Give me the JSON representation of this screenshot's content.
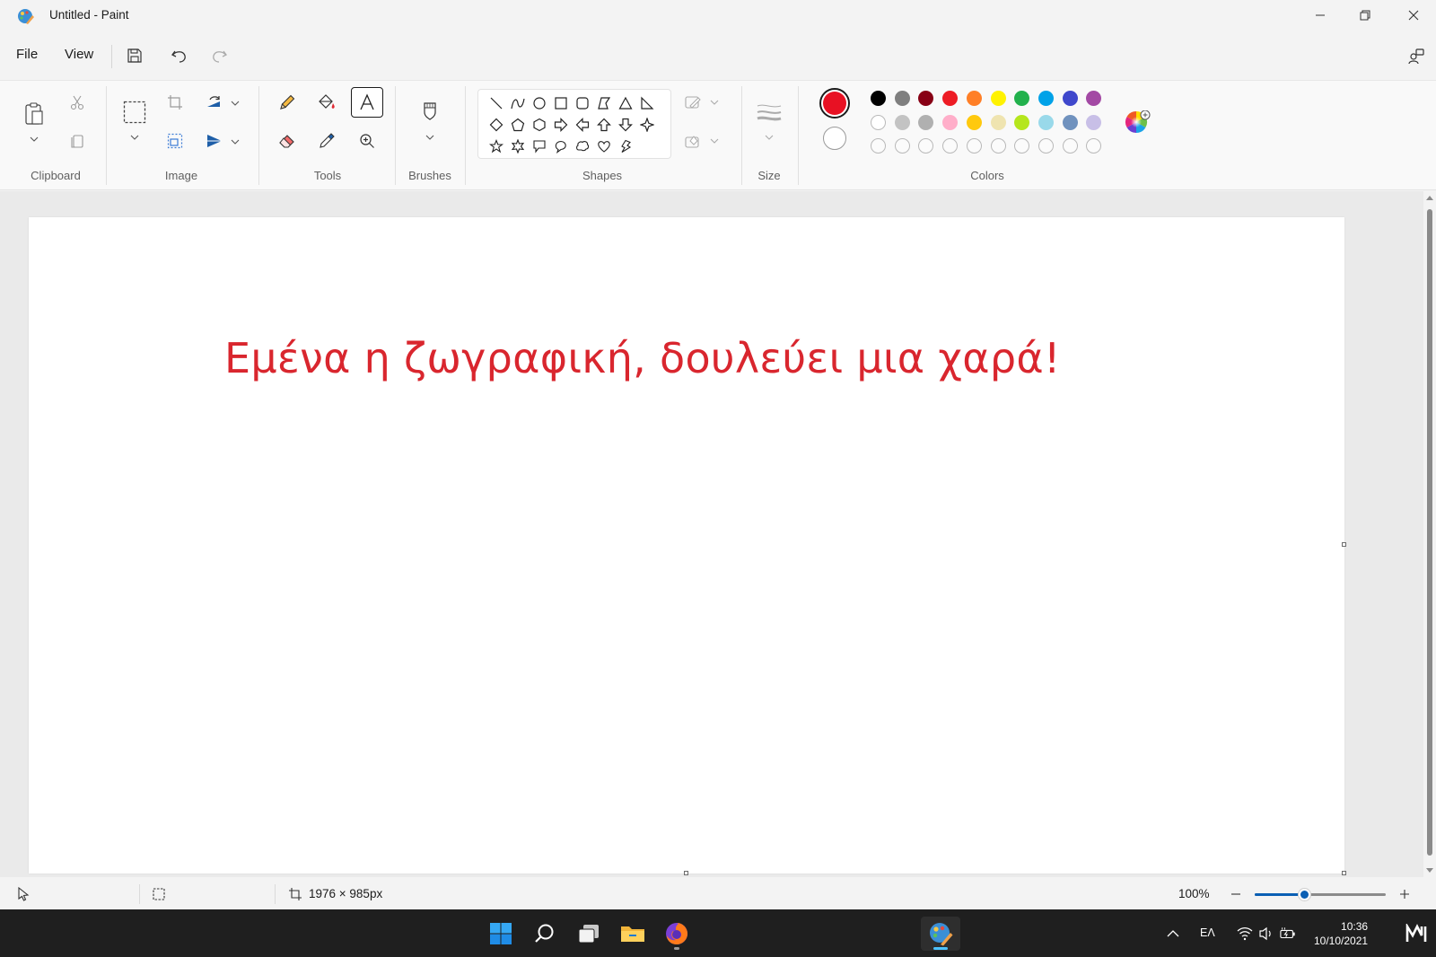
{
  "window": {
    "title": "Untitled - Paint"
  },
  "menu": {
    "file": "File",
    "view": "View"
  },
  "ribbon": {
    "groups": {
      "clipboard": "Clipboard",
      "image": "Image",
      "tools": "Tools",
      "brushes": "Brushes",
      "shapes": "Shapes",
      "size": "Size",
      "colors": "Colors"
    },
    "active_tool": "text-tool",
    "primary_color": "#e81123",
    "secondary_color": "#ffffff",
    "palette": [
      [
        "#000000",
        "#7f7f7f",
        "#880015",
        "#ed1c24",
        "#ff7f27",
        "#fff200",
        "#22b14c",
        "#00a2e8",
        "#3f48cc",
        "#a349a4"
      ],
      [
        "#ffffff",
        "#c3c3c3",
        "#b0b0b0",
        "#ffaec9",
        "#ffc90e",
        "#efe4b0",
        "#b5e61d",
        "#99d9ea",
        "#7092be",
        "#c8bfe7"
      ],
      [
        "",
        "",
        "",
        "",
        "",
        "",
        "",
        "",
        "",
        ""
      ]
    ]
  },
  "canvas": {
    "text": "Εμένα η ζωγραφική, δουλεύει μια χαρά!",
    "text_color": "#d9262e"
  },
  "status": {
    "dimensions": "1976 × 985px",
    "zoom": "100%",
    "zoom_value": 0.38
  },
  "taskbar": {
    "language": "ΕΛ",
    "time": "10:36",
    "date": "10/10/2021"
  }
}
